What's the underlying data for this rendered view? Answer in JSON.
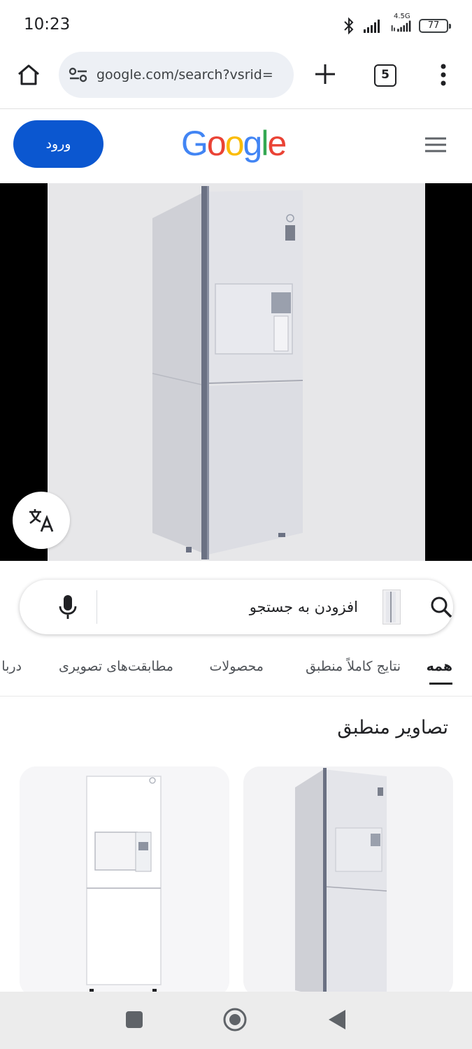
{
  "status_bar": {
    "time": "10:23",
    "network": "4.5G",
    "battery": "77"
  },
  "browser": {
    "url": "google.com/search?vsrid=",
    "tab_count": "5"
  },
  "google": {
    "sign_in_label": "ورود",
    "logo": [
      "G",
      "o",
      "o",
      "g",
      "l",
      "e"
    ],
    "logo_colors": [
      "#4285F4",
      "#EA4335",
      "#FBBC05",
      "#4285F4",
      "#34A853",
      "#EA4335"
    ]
  },
  "search": {
    "placeholder": "افزودن به جستجو"
  },
  "tabs": [
    {
      "label": "همه",
      "active": true
    },
    {
      "label": "نتایج کاملاً منطبق",
      "active": false
    },
    {
      "label": "محصولات",
      "active": false
    },
    {
      "label": "مطابقت‌های تصویری",
      "active": false
    },
    {
      "label": "دربا",
      "active": false
    }
  ],
  "results": {
    "section_title": "تصاویر منطبق"
  },
  "colors": {
    "accent": "#0b57d0",
    "viewer_bg": "#000000",
    "nav_bg": "#ececec"
  }
}
